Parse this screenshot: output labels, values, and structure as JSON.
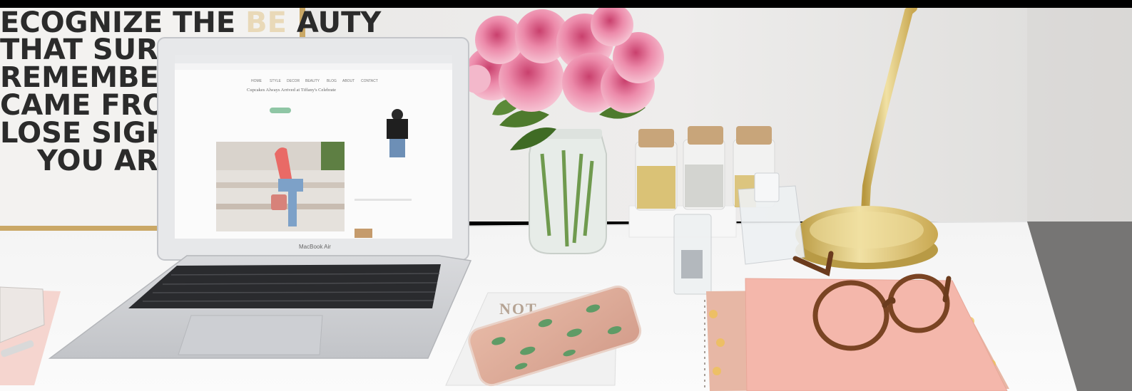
{
  "poster": {
    "lines": [
      {
        "before": "ECOGNIZE THE ",
        "highlight": "BE",
        "after": " AUTY"
      },
      {
        "before": "THAT SURROUNI",
        "highlight": "",
        "after": ""
      },
      {
        "before": "REMEMBER WHI",
        "highlight": "",
        "after": ""
      },
      {
        "before": "CAME FROM, BUT",
        "highlight": "",
        "after": ""
      },
      {
        "before": "LOSE SIGHT OF",
        "highlight": "",
        "after": ""
      },
      {
        "before": "YOU ARE GO",
        "highlight": "",
        "after": ""
      }
    ]
  },
  "laptop": {
    "brand": "MacBook Air",
    "screen": {
      "nav": [
        "HOME",
        "STYLE",
        "DECOR",
        "BEAUTY",
        "BLOG",
        "ABOUT",
        "CONTACT"
      ],
      "heading": "Cupcakes Always Arrived at Tiffany's Celebrate"
    }
  },
  "notebook": {
    "cover_text": "NOT"
  },
  "colors": {
    "wall": "#ecebea",
    "desk": "#f5f5f5",
    "rose": "#e8769a",
    "brass": "#d9bf70",
    "notebook_pink": "#f4b7ab"
  }
}
